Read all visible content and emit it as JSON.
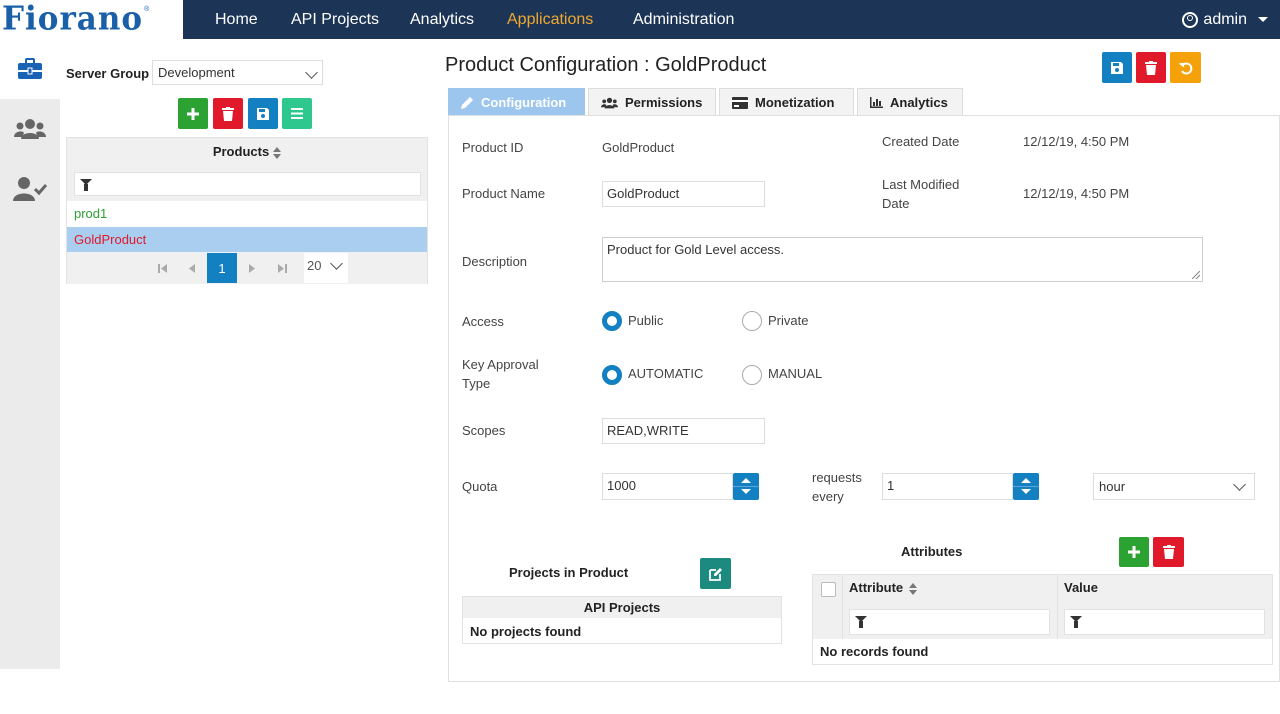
{
  "brand": {
    "logo_text": "Fiorano",
    "trademark": "®"
  },
  "nav": {
    "items": [
      {
        "label": "Home"
      },
      {
        "label": "API Projects"
      },
      {
        "label": "Analytics"
      },
      {
        "label": "Applications",
        "active": true
      },
      {
        "label": "Administration"
      }
    ],
    "user": "admin"
  },
  "sidebar": {
    "items": [
      {
        "icon": "briefcase-icon",
        "active": true
      },
      {
        "icon": "users-icon",
        "active": false
      },
      {
        "icon": "user-check-icon",
        "active": false
      }
    ]
  },
  "left_panel": {
    "server_group_label": "Server Group",
    "server_group_value": "Development",
    "grid": {
      "header": "Products",
      "rows": [
        {
          "name": "prod1",
          "selected": false
        },
        {
          "name": "GoldProduct",
          "selected": true
        }
      ],
      "pager": {
        "current_page": "1",
        "page_size": "20"
      }
    }
  },
  "main": {
    "title": "Product Configuration : GoldProduct",
    "tabs": [
      {
        "label": "Configuration",
        "icon": "pencil-icon",
        "active": true
      },
      {
        "label": "Permissions",
        "icon": "users-icon",
        "active": false
      },
      {
        "label": "Monetization",
        "icon": "credit-card-icon",
        "active": false
      },
      {
        "label": "Analytics",
        "icon": "bar-chart-icon",
        "active": false
      }
    ],
    "form": {
      "product_id_label": "Product ID",
      "product_id_value": "GoldProduct",
      "created_date_label": "Created Date",
      "created_date_value": "12/12/19, 4:50 PM",
      "product_name_label": "Product Name",
      "product_name_value": "GoldProduct",
      "last_modified_label_1": "Last Modified",
      "last_modified_label_2": "Date",
      "last_modified_value": "12/12/19, 4:50 PM",
      "description_label": "Description",
      "description_value": "Product for Gold Level access.",
      "access_label": "Access",
      "access_options": [
        "Public",
        "Private"
      ],
      "access_selected": "Public",
      "key_approval_label_1": "Key Approval",
      "key_approval_label_2": "Type",
      "key_approval_options": [
        "AUTOMATIC",
        "MANUAL"
      ],
      "key_approval_selected": "AUTOMATIC",
      "scopes_label": "Scopes",
      "scopes_value": "READ,WRITE",
      "quota_label": "Quota",
      "quota_value": "1000",
      "requests_every_1": "requests",
      "requests_every_2": "every",
      "interval_value": "1",
      "interval_unit": "hour"
    },
    "projects": {
      "title": "Projects in Product",
      "column": "API Projects",
      "empty": "No projects found"
    },
    "attributes": {
      "title": "Attributes",
      "columns": [
        "Attribute",
        "Value"
      ],
      "empty": "No records found"
    }
  }
}
